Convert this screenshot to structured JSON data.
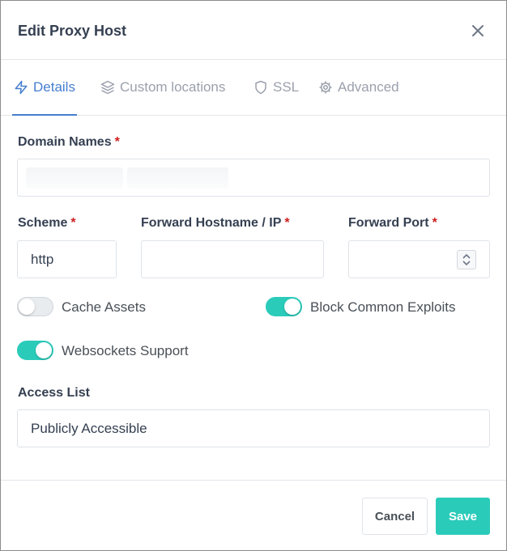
{
  "modal": {
    "title": "Edit Proxy Host"
  },
  "tabs": [
    {
      "label": "Details",
      "icon": "zap-icon",
      "active": true
    },
    {
      "label": "Custom locations",
      "icon": "layers-icon",
      "active": false
    },
    {
      "label": "SSL",
      "icon": "shield-icon",
      "active": false
    },
    {
      "label": "Advanced",
      "icon": "gear-icon",
      "active": false
    }
  ],
  "form": {
    "domain_names": {
      "label": "Domain Names",
      "required_mark": "*"
    },
    "scheme": {
      "label": "Scheme",
      "required_mark": "*",
      "value": "http"
    },
    "forward_host": {
      "label": "Forward Hostname / IP",
      "required_mark": "*",
      "value": ""
    },
    "forward_port": {
      "label": "Forward Port",
      "required_mark": "*",
      "value": ""
    },
    "cache_assets": {
      "label": "Cache Assets",
      "enabled": false
    },
    "block_exploits": {
      "label": "Block Common Exploits",
      "enabled": true
    },
    "websockets": {
      "label": "Websockets Support",
      "enabled": true
    },
    "access_list": {
      "label": "Access List",
      "value": "Publicly Accessible"
    }
  },
  "footer": {
    "cancel_label": "Cancel",
    "save_label": "Save"
  },
  "colors": {
    "accent": "#467fcf",
    "toggle_on": "#2bcbba",
    "required": "#cd201f"
  }
}
